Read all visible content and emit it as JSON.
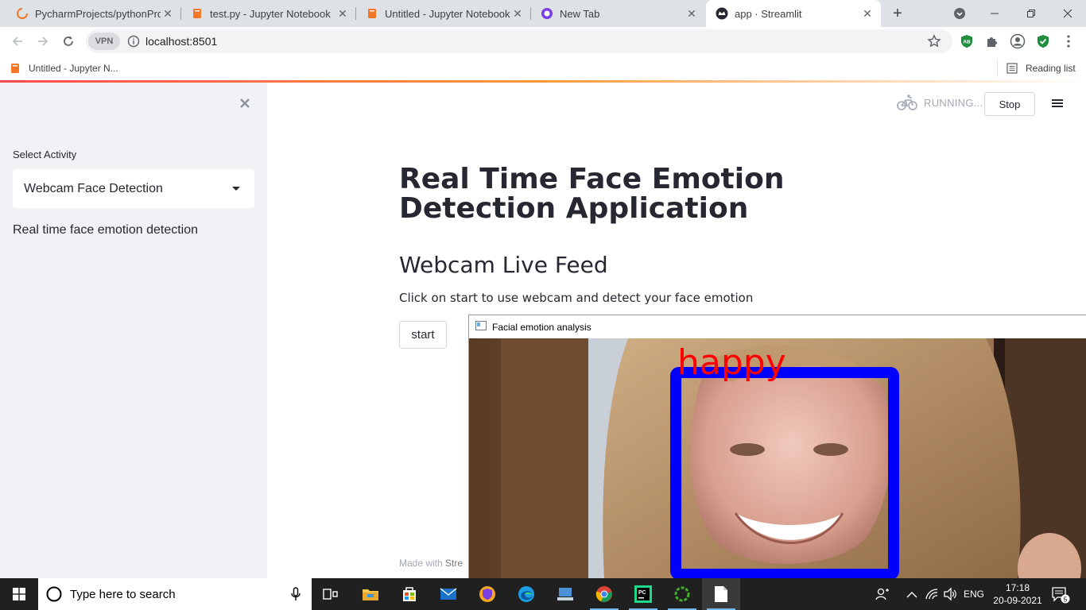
{
  "browser": {
    "tabs": [
      {
        "title": "PycharmProjects/pythonProje",
        "icon": "pycharm-spinner-icon",
        "active": false
      },
      {
        "title": "test.py - Jupyter Notebook",
        "icon": "jupyter-book-icon",
        "active": false
      },
      {
        "title": "Untitled - Jupyter Notebook",
        "icon": "jupyter-book-icon",
        "active": false
      },
      {
        "title": "New Tab",
        "icon": "new-tab-icon",
        "active": false
      },
      {
        "title": "app · Streamlit",
        "icon": "streamlit-crown-icon",
        "active": true
      }
    ],
    "vpn_label": "VPN",
    "url": "localhost:8501",
    "bookmark": "Untitled - Jupyter N...",
    "reading_list": "Reading list",
    "ext_ab_label": "AB"
  },
  "streamlit": {
    "sidebar": {
      "select_label": "Select Activity",
      "select_value": "Webcam Face Detection",
      "description": "Real time face emotion detection"
    },
    "header": {
      "status": "RUNNING...",
      "stop_label": "Stop"
    },
    "main": {
      "title": "Real Time Face Emotion Detection Application",
      "subheader": "Webcam Live Feed",
      "instruction": "Click on start to use webcam and detect your face emotion",
      "start_label": "start",
      "footer_prefix": "Made with ",
      "footer_brand": "Stre"
    }
  },
  "opencv_window": {
    "title": "Facial emotion analysis",
    "emotion_label": "happy",
    "label_color": "#ff0000",
    "box_color": "#0000ff"
  },
  "taskbar": {
    "search_placeholder": "Type here to search",
    "language": "ENG",
    "time": "17:18",
    "date": "20-09-2021",
    "notification_count": "5"
  },
  "colors": {
    "streamlit_accent": "#ff4b4b",
    "sidebar_bg": "#f0f2f6",
    "text": "#262730"
  }
}
